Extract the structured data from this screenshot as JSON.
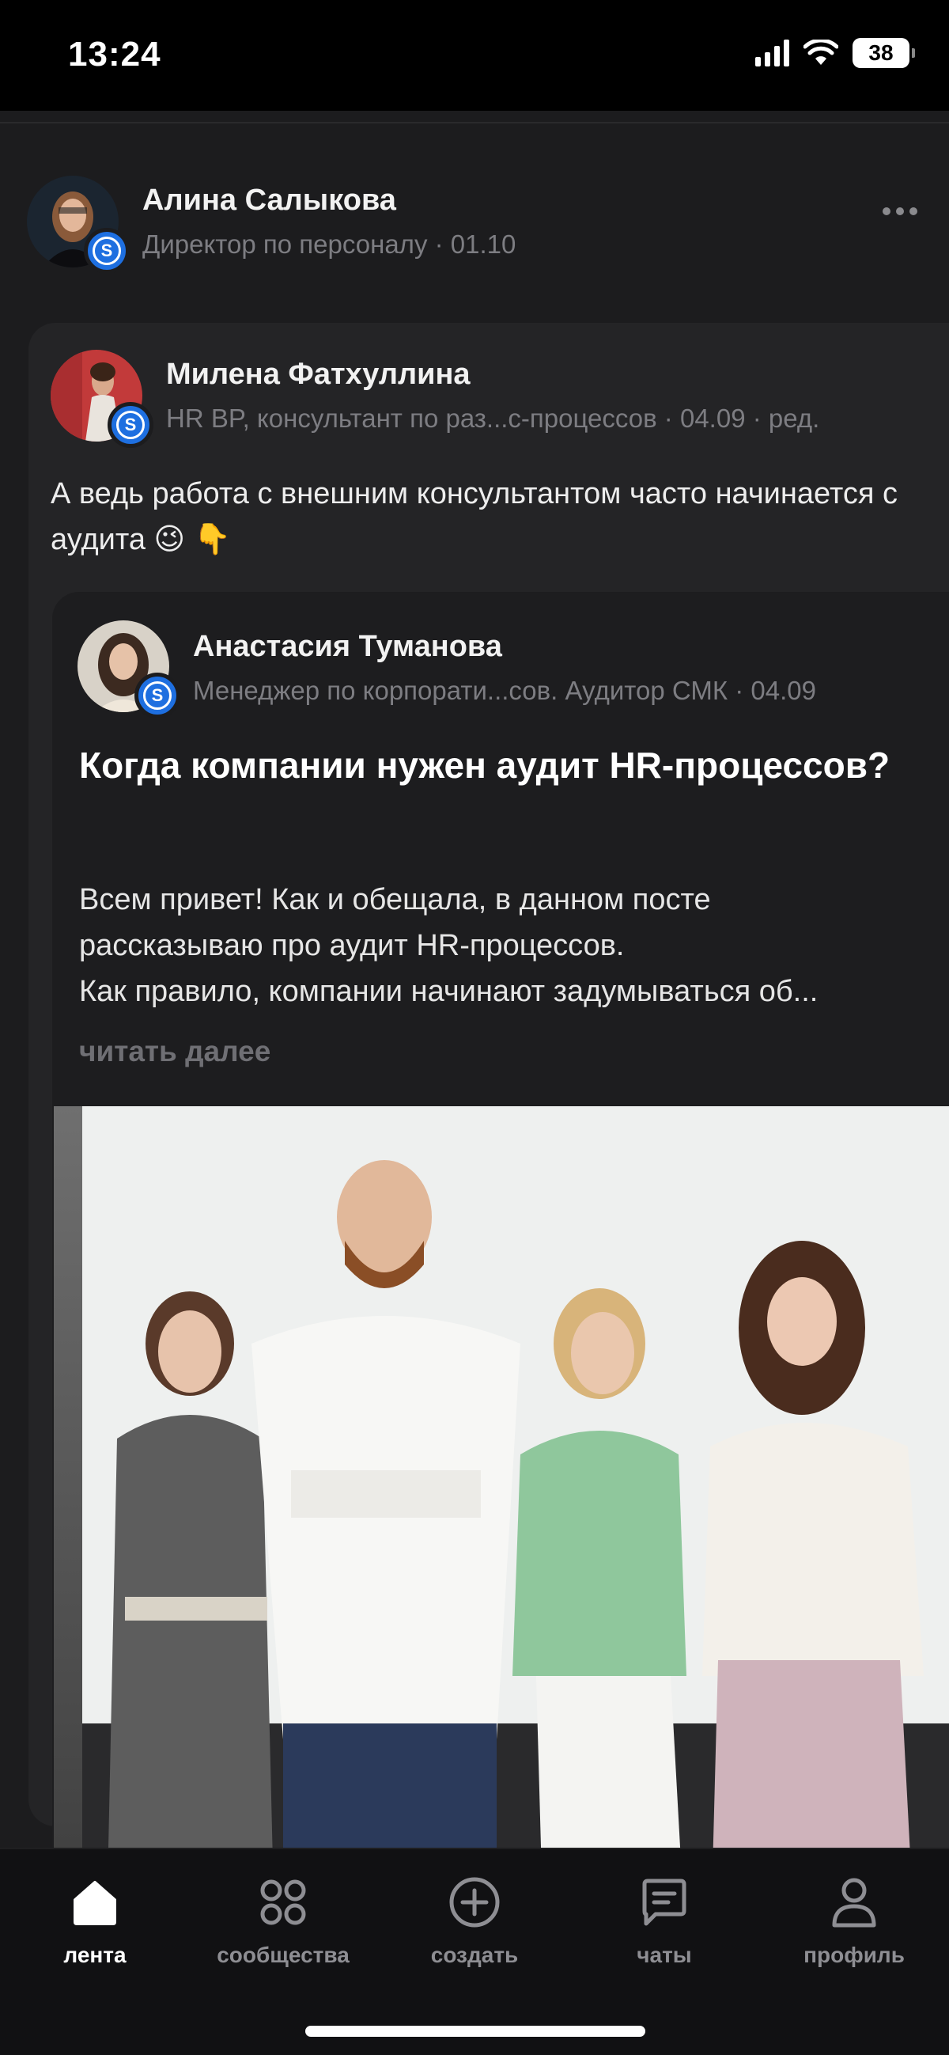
{
  "status_bar": {
    "time": "13:24",
    "battery": "38"
  },
  "feed": {
    "author": {
      "name": "Алина Салыкова",
      "meta": "Директор по персоналу · 01.10",
      "badge": "S"
    },
    "repost": {
      "author_name": "Милена Фатхуллина",
      "author_meta": "HR BP, консультант по раз...с-процессов · 04.09 · ред.",
      "badge": "S",
      "text": "А ведь работа с внешним консультантом часто начинается с аудита 😉 👇"
    },
    "original_post": {
      "author_name": "Анастасия Туманова",
      "author_meta": "Менеджер по корпорати...сов. Аудитор СМК · 04.09",
      "badge": "S",
      "title": "Когда компании нужен аудит HR-процессов?",
      "body_lines": [
        "Всем привет! Как и обещала, в данном посте",
        "рассказываю про аудит HR-процессов.",
        "Как правило, компании начинают задумываться об..."
      ],
      "read_more": "читать далее"
    }
  },
  "bottom_nav": {
    "items": [
      {
        "label": "лента",
        "icon": "home-icon",
        "active": true
      },
      {
        "label": "сообщества",
        "icon": "grid-icon",
        "active": false
      },
      {
        "label": "создать",
        "icon": "plus-circle-icon",
        "active": false
      },
      {
        "label": "чаты",
        "icon": "chat-icon",
        "active": false
      },
      {
        "label": "профиль",
        "icon": "person-icon",
        "active": false
      }
    ]
  },
  "colors": {
    "accent_badge": "#1e6fe0",
    "background": "#1c1c1e",
    "card": "#242426"
  }
}
